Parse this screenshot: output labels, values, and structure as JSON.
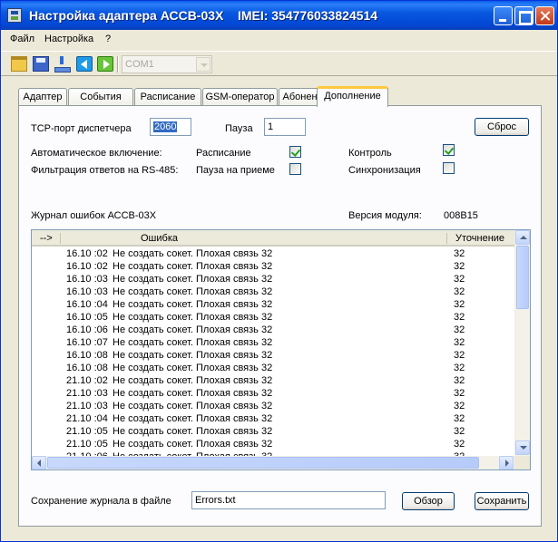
{
  "window": {
    "title": "Настройка адаптера АССВ-03Х    IMEI: 354776033824514"
  },
  "menu": [
    "Файл",
    "Настройка",
    "?"
  ],
  "toolbar": {
    "port_value": "COM1"
  },
  "tabs": [
    "Адаптер",
    "События",
    "Расписание",
    "GSM-оператор",
    "Абоненты",
    "Дополнение"
  ],
  "active_tab": "Дополнение",
  "settings": {
    "tcp_port_label": "TCP-порт диспетчера",
    "tcp_port_value": "2060",
    "pause_label": "Пауза",
    "pause_value": "1",
    "reset_label": "Сброс",
    "auto_on_label": "Автоматическое включение:",
    "filter_label": "Фильтрация ответов на RS-485:",
    "schedule_label": "Расписание",
    "schedule_checked": true,
    "pause_on_receive_label": "Пауза на приеме",
    "pause_on_receive_checked": false,
    "control_label": "Контроль",
    "control_checked": true,
    "sync_label": "Синхронизация",
    "sync_checked": false
  },
  "log": {
    "title": "Журнал ошибок АССВ-03Х",
    "module_version_label": "Версия модуля:",
    "module_version_value": "008B15",
    "columns": [
      "-->",
      "Ошибка",
      "Уточнение"
    ],
    "rows": [
      {
        "time": "16.10 :02",
        "error": "Не создать сокет. Плохая связь  32",
        "detail": "32"
      },
      {
        "time": "16.10 :02",
        "error": "Не создать сокет. Плохая связь  32",
        "detail": "32"
      },
      {
        "time": "16.10 :03",
        "error": "Не создать сокет. Плохая связь  32",
        "detail": "32"
      },
      {
        "time": "16.10 :03",
        "error": "Не создать сокет. Плохая связь  32",
        "detail": "32"
      },
      {
        "time": "16.10 :04",
        "error": "Не создать сокет. Плохая связь  32",
        "detail": "32"
      },
      {
        "time": "16.10 :05",
        "error": "Не создать сокет. Плохая связь  32",
        "detail": "32"
      },
      {
        "time": "16.10 :06",
        "error": "Не создать сокет. Плохая связь  32",
        "detail": "32"
      },
      {
        "time": "16.10 :07",
        "error": "Не создать сокет. Плохая связь  32",
        "detail": "32"
      },
      {
        "time": "16.10 :08",
        "error": "Не создать сокет. Плохая связь  32",
        "detail": "32"
      },
      {
        "time": "16.10 :08",
        "error": "Не создать сокет. Плохая связь  32",
        "detail": "32"
      },
      {
        "time": "21.10 :02",
        "error": "Не создать сокет. Плохая связь  32",
        "detail": "32"
      },
      {
        "time": "21.10 :03",
        "error": "Не создать сокет. Плохая связь  32",
        "detail": "32"
      },
      {
        "time": "21.10 :03",
        "error": "Не создать сокет. Плохая связь  32",
        "detail": "32"
      },
      {
        "time": "21.10 :04",
        "error": "Не создать сокет. Плохая связь  32",
        "detail": "32"
      },
      {
        "time": "21.10 :05",
        "error": "Не создать сокет. Плохая связь  32",
        "detail": "32"
      },
      {
        "time": "21.10 :05",
        "error": "Не создать сокет. Плохая связь  32",
        "detail": "32"
      },
      {
        "time": "21.10 :06",
        "error": "Не создать сокет. Плохая связь  32",
        "detail": "32"
      }
    ]
  },
  "footer": {
    "save_log_label": "Сохранение журнала в файле",
    "file_value": "Errors.txt",
    "browse_label": "Обзор",
    "save_label": "Сохранить"
  }
}
